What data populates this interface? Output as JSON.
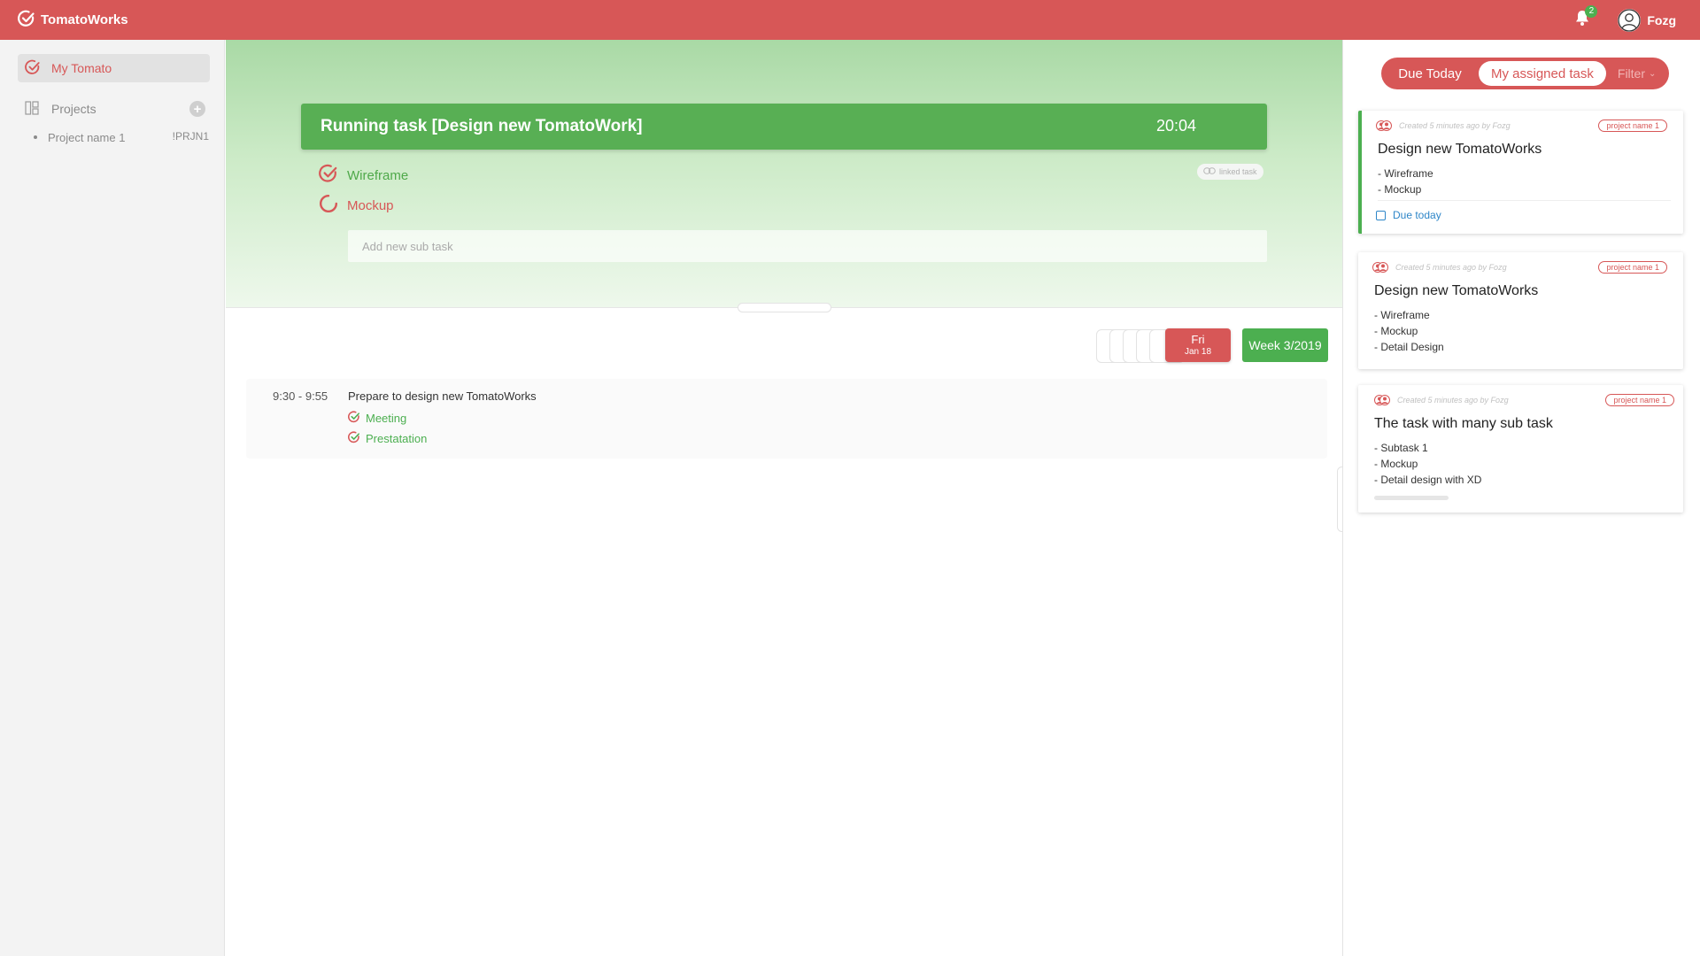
{
  "app": {
    "name": "TomatoWorks"
  },
  "header": {
    "notification_count": "2",
    "user_name": "Fozg"
  },
  "sidebar": {
    "my_tomato_label": "My Tomato",
    "projects_label": "Projects",
    "add_project_label": "+",
    "projects": [
      {
        "name": "Project name 1",
        "code": "!PRJN1"
      }
    ]
  },
  "running": {
    "title": "Running task [Design new TomatoWork]",
    "timer": "20:04",
    "linked_label": "linked task",
    "subtasks": [
      {
        "label": "Wireframe",
        "status": "done"
      },
      {
        "label": "Mockup",
        "status": "in-progress"
      }
    ],
    "add_placeholder": "Add new sub task"
  },
  "schedule": {
    "day": {
      "weekday": "Fri",
      "date": "Jan 18"
    },
    "week_label": "Week 3/2019",
    "items": [
      {
        "time": "9:30 - 9:55",
        "title": "Prepare to design new TomatoWorks",
        "subtasks": [
          "Meeting",
          "Prestatation"
        ]
      }
    ]
  },
  "right_panel": {
    "tabs": {
      "due_today": "Due Today",
      "assigned": "My assigned task",
      "filter": "Filter"
    },
    "cards": [
      {
        "meta": "Created 5 minutes ago by Fozg",
        "tag": "project name 1",
        "title": "Design new TomatoWorks",
        "subtasks": [
          "- Wireframe",
          "- Mockup"
        ],
        "due": "Due today"
      },
      {
        "meta": "Created 5 minutes ago by Fozg",
        "tag": "project name 1",
        "title": "Design new TomatoWorks",
        "subtasks": [
          "- Wireframe",
          "- Mockup",
          "- Detail Design"
        ]
      },
      {
        "meta": "Created 5 minutes ago by Fozg",
        "tag": "project name 1",
        "title": "The task with many sub task",
        "subtasks": [
          "- Subtask 1",
          "- Mockup",
          "- Detail design with XD"
        ]
      }
    ]
  },
  "colors": {
    "brand_red": "#d75757",
    "success_green": "#4caf50",
    "link_blue": "#2e86c8"
  },
  "icons": {
    "brand": "check-circle-icon",
    "notification": "bell-icon",
    "user": "user-avatar-icon",
    "projects": "kanban-icon",
    "subtask_done": "check-circle-icon",
    "subtask_progress": "spinner-icon",
    "linked": "link-icon",
    "calendar": "calendar-icon"
  }
}
